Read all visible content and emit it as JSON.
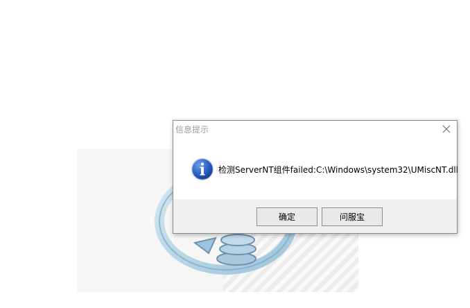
{
  "dialog": {
    "title": "信息提示",
    "message": "检测ServerNT组件failed:C:\\Windows\\system32\\UMiscNT.dll",
    "icon": "info-icon",
    "close_icon": "close-icon",
    "buttons": {
      "ok_label": "确定",
      "help_label": "问服宝"
    }
  },
  "colors": {
    "footer_bg": "#f0f0f0",
    "icon_blue": "#1f4fb8",
    "title_text": "#9a9a9a"
  }
}
